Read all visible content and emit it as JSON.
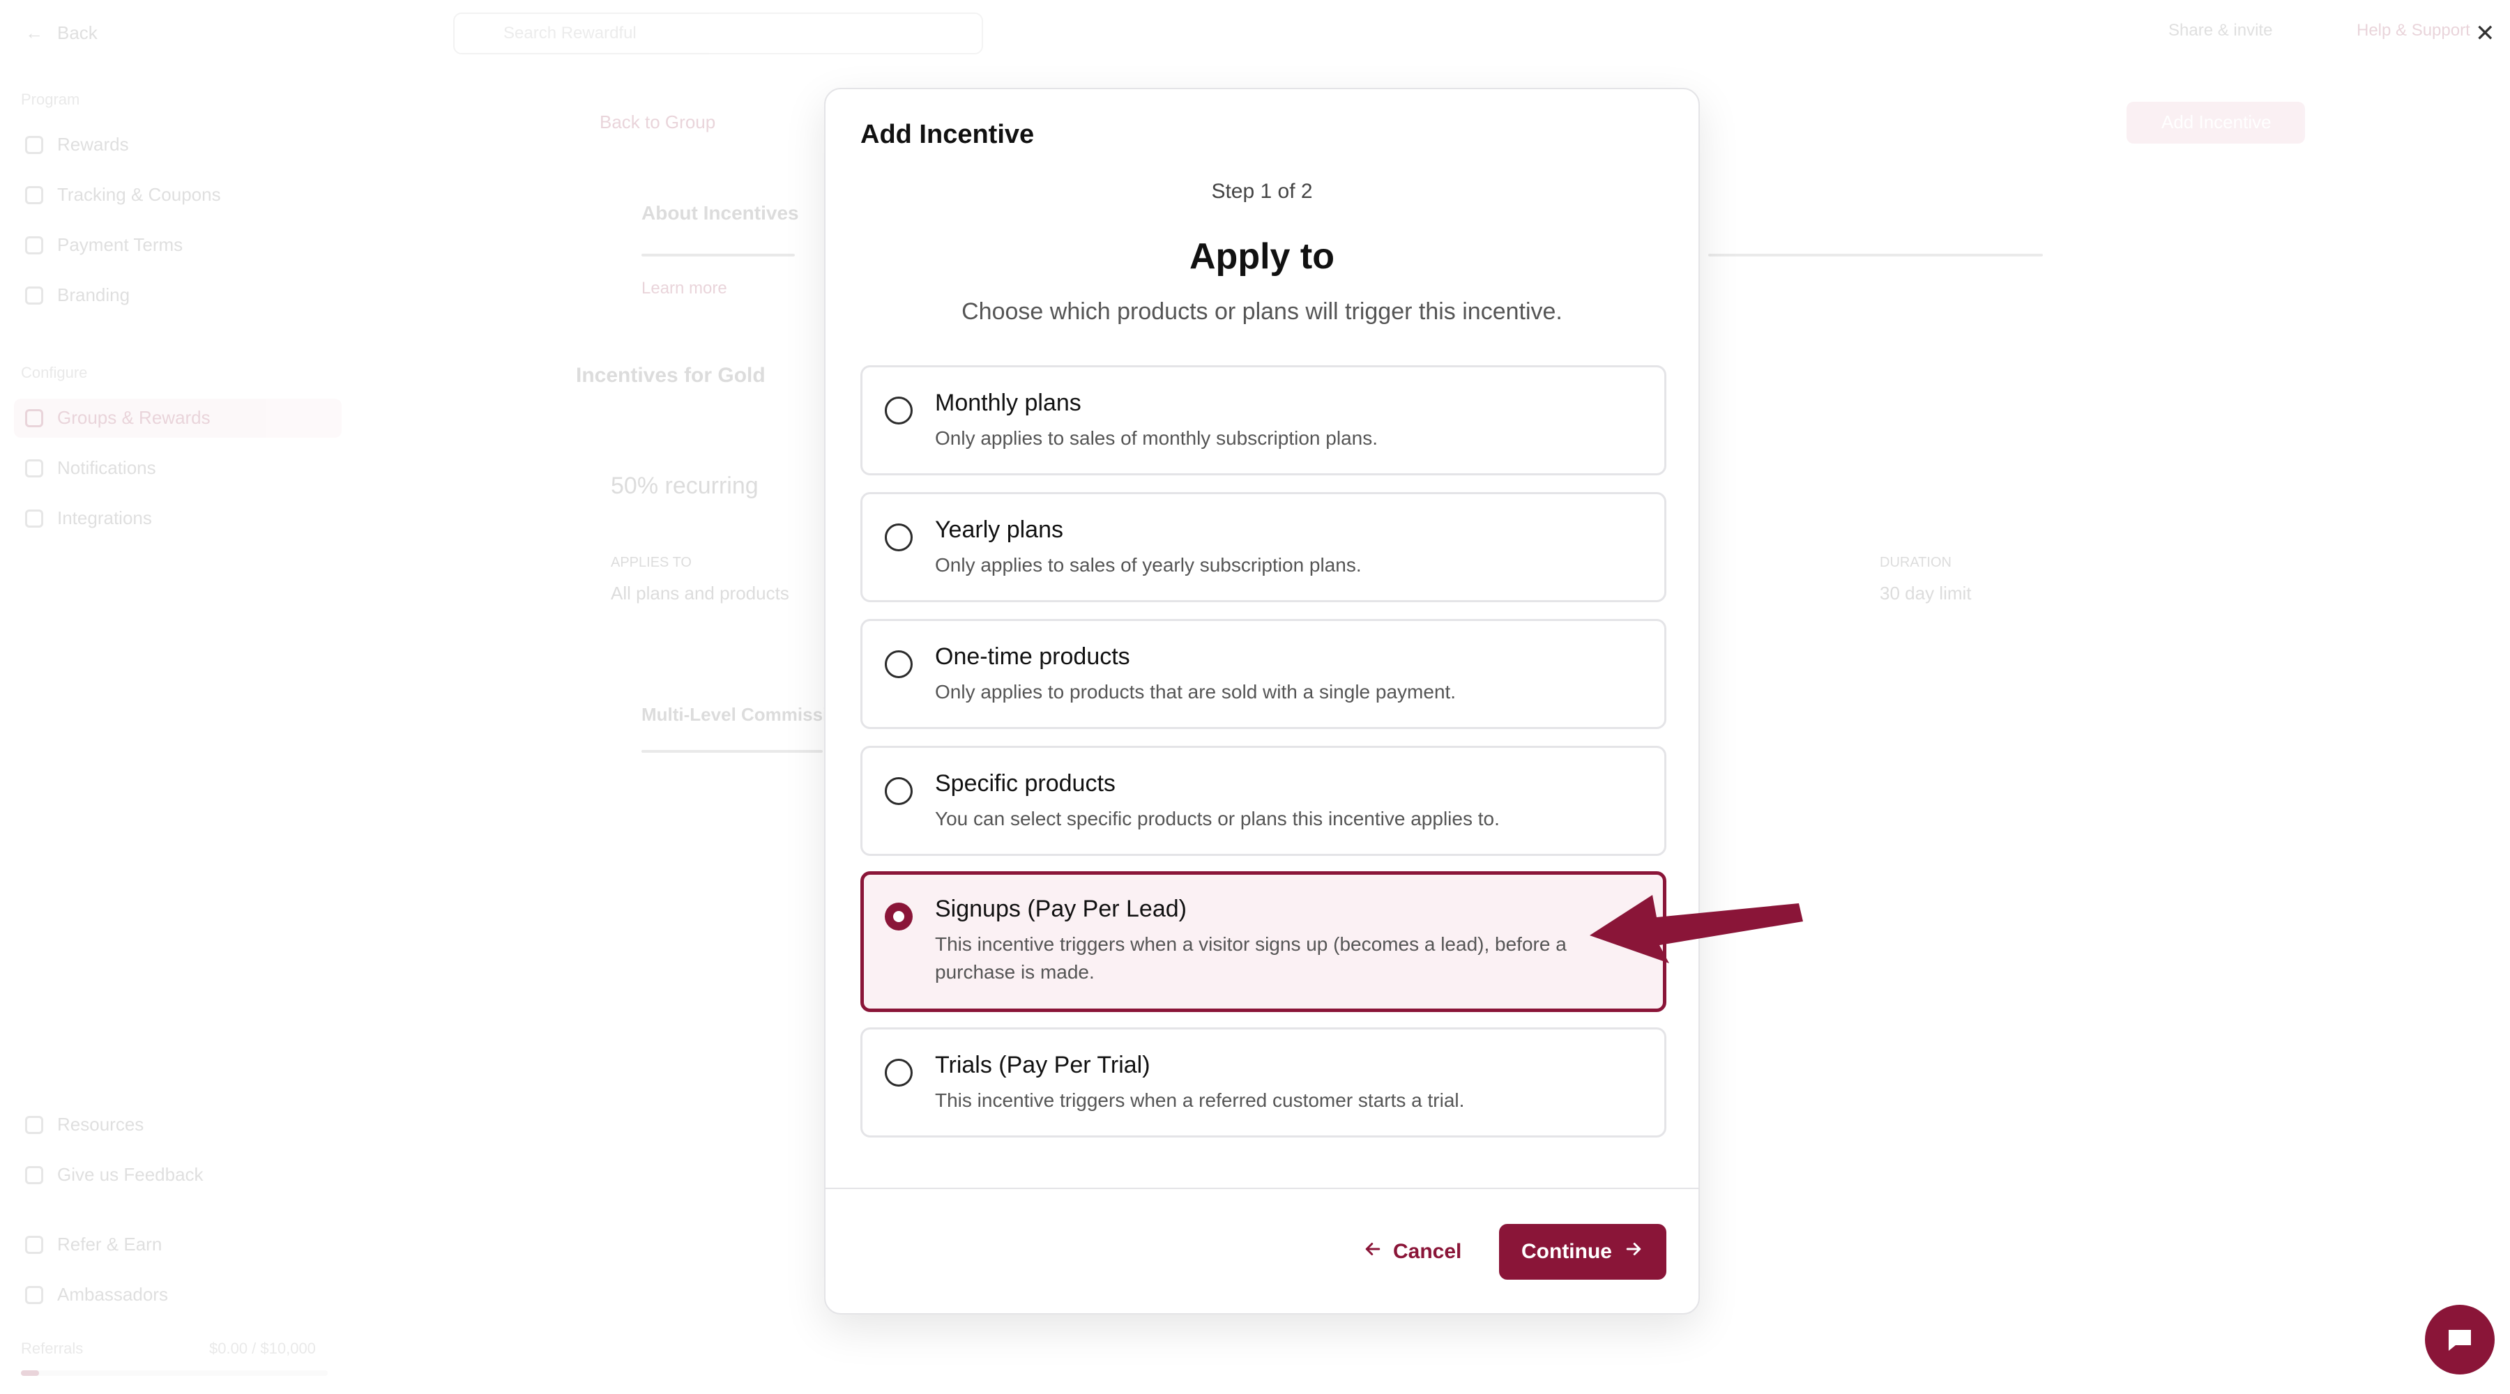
{
  "background": {
    "sidebar": {
      "brand": "Back",
      "sections": [
        {
          "heading": "Program",
          "items": [
            "Rewards",
            "Tracking & Coupons",
            "Payment Terms",
            "Branding"
          ]
        },
        {
          "heading": "Configure",
          "items": [
            "Groups & Rewards",
            "Notifications",
            "Integrations"
          ]
        }
      ],
      "bottom_items": [
        "Resources",
        "Give us Feedback",
        "Refer & Earn",
        "Ambassadors"
      ],
      "usage": {
        "label": "Referrals",
        "value": "$0.00 / $10,000"
      }
    },
    "search_placeholder": "Search Rewardful",
    "top_right": [
      "Share & invite",
      "Help & Support"
    ],
    "page": {
      "back_link": "Back to Group",
      "add_incentive": "Add Incentive",
      "about_title": "About Incentives",
      "learn_more": "Learn more",
      "section_title": "Incentives for Gold",
      "incentive_name": "50% recurring",
      "applies_label": "APPLIES TO",
      "applies_value": "All plans and products",
      "duration_label": "DURATION",
      "duration_value": "30 day limit",
      "multi_level": "Multi-Level Commissions"
    }
  },
  "modal": {
    "title": "Add Incentive",
    "step": "Step 1 of 2",
    "heading": "Apply to",
    "subheading": "Choose which products or plans will trigger this incentive.",
    "options": [
      {
        "label": "Monthly plans",
        "desc": "Only applies to sales of monthly subscription plans."
      },
      {
        "label": "Yearly plans",
        "desc": "Only applies to sales of yearly subscription plans."
      },
      {
        "label": "One-time products",
        "desc": "Only applies to products that are sold with a single payment."
      },
      {
        "label": "Specific products",
        "desc": "You can select specific products or plans this incentive applies to."
      },
      {
        "label": "Signups (Pay Per Lead)",
        "desc": "This incentive triggers when a visitor signs up (becomes a lead), before a purchase is made."
      },
      {
        "label": "Trials (Pay Per Trial)",
        "desc": "This incentive triggers when a referred customer starts a trial."
      }
    ],
    "selected_option": "Signups (Pay Per Lead)",
    "cancel_label": "Cancel",
    "continue_label": "Continue"
  },
  "colors": {
    "accent": "#8a1538",
    "selected_bg": "#fbf1f4",
    "border": "#e4e4e7"
  },
  "icons": [
    "close-icon",
    "arrow-left-icon",
    "arrow-right-icon",
    "chat-icon",
    "pointer-arrow-icon"
  ]
}
